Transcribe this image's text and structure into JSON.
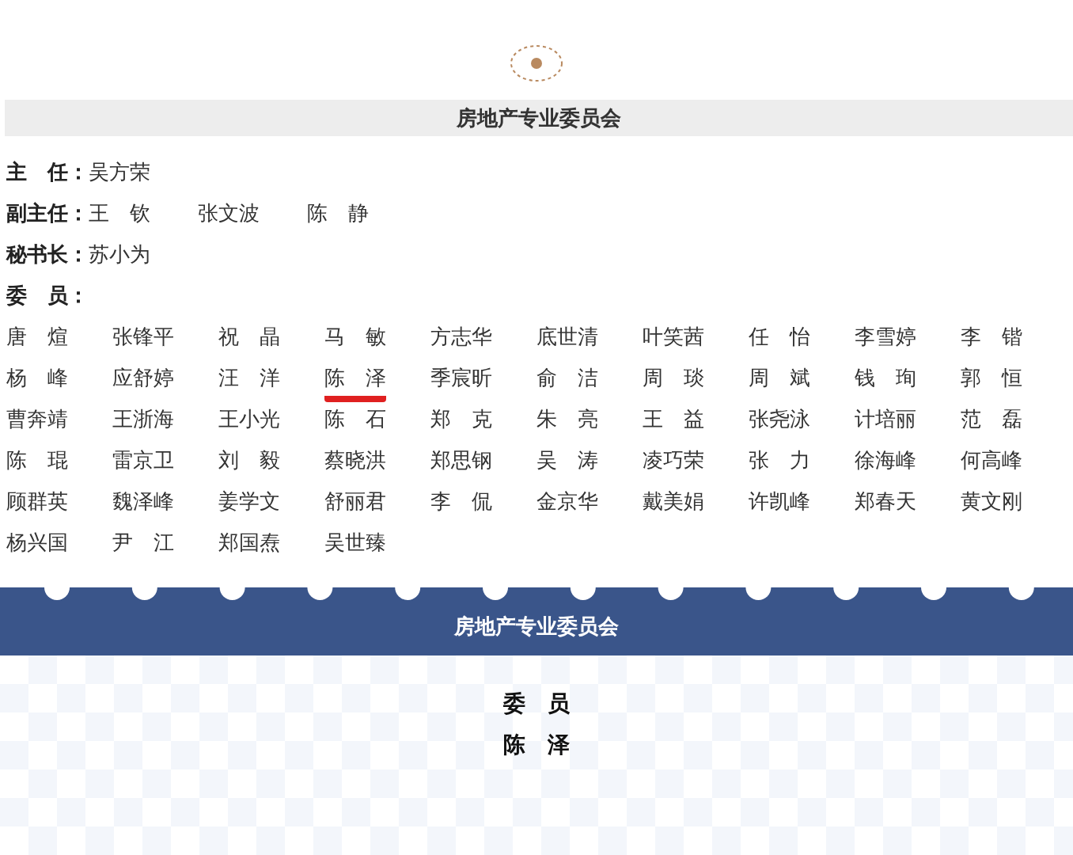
{
  "section_title": "房地产专业委员会",
  "officers": [
    {
      "label": "主　任：",
      "names": [
        "吴方荣"
      ]
    },
    {
      "label": "副主任：",
      "names": [
        "王　钦",
        "张文波",
        "陈　静"
      ]
    },
    {
      "label": "秘书长：",
      "names": [
        "苏小为"
      ]
    },
    {
      "label": "委　员："
    }
  ],
  "members": [
    {
      "name": "唐　煊",
      "highlighted": false
    },
    {
      "name": "张锋平",
      "highlighted": false
    },
    {
      "name": "祝　晶",
      "highlighted": false
    },
    {
      "name": "马　敏",
      "highlighted": false
    },
    {
      "name": "方志华",
      "highlighted": false
    },
    {
      "name": "底世清",
      "highlighted": false
    },
    {
      "name": "叶笑茜",
      "highlighted": false
    },
    {
      "name": "任　怡",
      "highlighted": false
    },
    {
      "name": "李雪婷",
      "highlighted": false
    },
    {
      "name": "李　锴",
      "highlighted": false
    },
    {
      "name": "杨　峰",
      "highlighted": false
    },
    {
      "name": "应舒婷",
      "highlighted": false
    },
    {
      "name": "汪　洋",
      "highlighted": false
    },
    {
      "name": "陈　泽",
      "highlighted": true
    },
    {
      "name": "季宸昕",
      "highlighted": false
    },
    {
      "name": "俞　洁",
      "highlighted": false
    },
    {
      "name": "周　琰",
      "highlighted": false
    },
    {
      "name": "周　斌",
      "highlighted": false
    },
    {
      "name": "钱　珣",
      "highlighted": false
    },
    {
      "name": "郭　恒",
      "highlighted": false
    },
    {
      "name": "曹奔靖",
      "highlighted": false
    },
    {
      "name": "王浙海",
      "highlighted": false
    },
    {
      "name": "王小光",
      "highlighted": false
    },
    {
      "name": "陈　石",
      "highlighted": false
    },
    {
      "name": "郑　克",
      "highlighted": false
    },
    {
      "name": "朱　亮",
      "highlighted": false
    },
    {
      "name": "王　益",
      "highlighted": false
    },
    {
      "name": "张尧泳",
      "highlighted": false
    },
    {
      "name": "计培丽",
      "highlighted": false
    },
    {
      "name": "范　磊",
      "highlighted": false
    },
    {
      "name": "陈　琨",
      "highlighted": false
    },
    {
      "name": "雷京卫",
      "highlighted": false
    },
    {
      "name": "刘　毅",
      "highlighted": false
    },
    {
      "name": "蔡晓洪",
      "highlighted": false
    },
    {
      "name": "郑思钢",
      "highlighted": false
    },
    {
      "name": "吴　涛",
      "highlighted": false
    },
    {
      "name": "凌巧荣",
      "highlighted": false
    },
    {
      "name": "张　力",
      "highlighted": false
    },
    {
      "name": "徐海峰",
      "highlighted": false
    },
    {
      "name": "何高峰",
      "highlighted": false
    },
    {
      "name": "顾群英",
      "highlighted": false
    },
    {
      "name": "魏泽峰",
      "highlighted": false
    },
    {
      "name": "姜学文",
      "highlighted": false
    },
    {
      "name": "舒丽君",
      "highlighted": false
    },
    {
      "name": "李　侃",
      "highlighted": false
    },
    {
      "name": "金京华",
      "highlighted": false
    },
    {
      "name": "戴美娟",
      "highlighted": false
    },
    {
      "name": "许凯峰",
      "highlighted": false
    },
    {
      "name": "郑春天",
      "highlighted": false
    },
    {
      "name": "黄文刚",
      "highlighted": false
    },
    {
      "name": "杨兴国",
      "highlighted": false
    },
    {
      "name": "尹　江",
      "highlighted": false
    },
    {
      "name": "郑国焘",
      "highlighted": false
    },
    {
      "name": "吴世臻",
      "highlighted": false
    }
  ],
  "card": {
    "title": "房地产专业委员会",
    "role": "委　员",
    "name": "陈　泽"
  }
}
